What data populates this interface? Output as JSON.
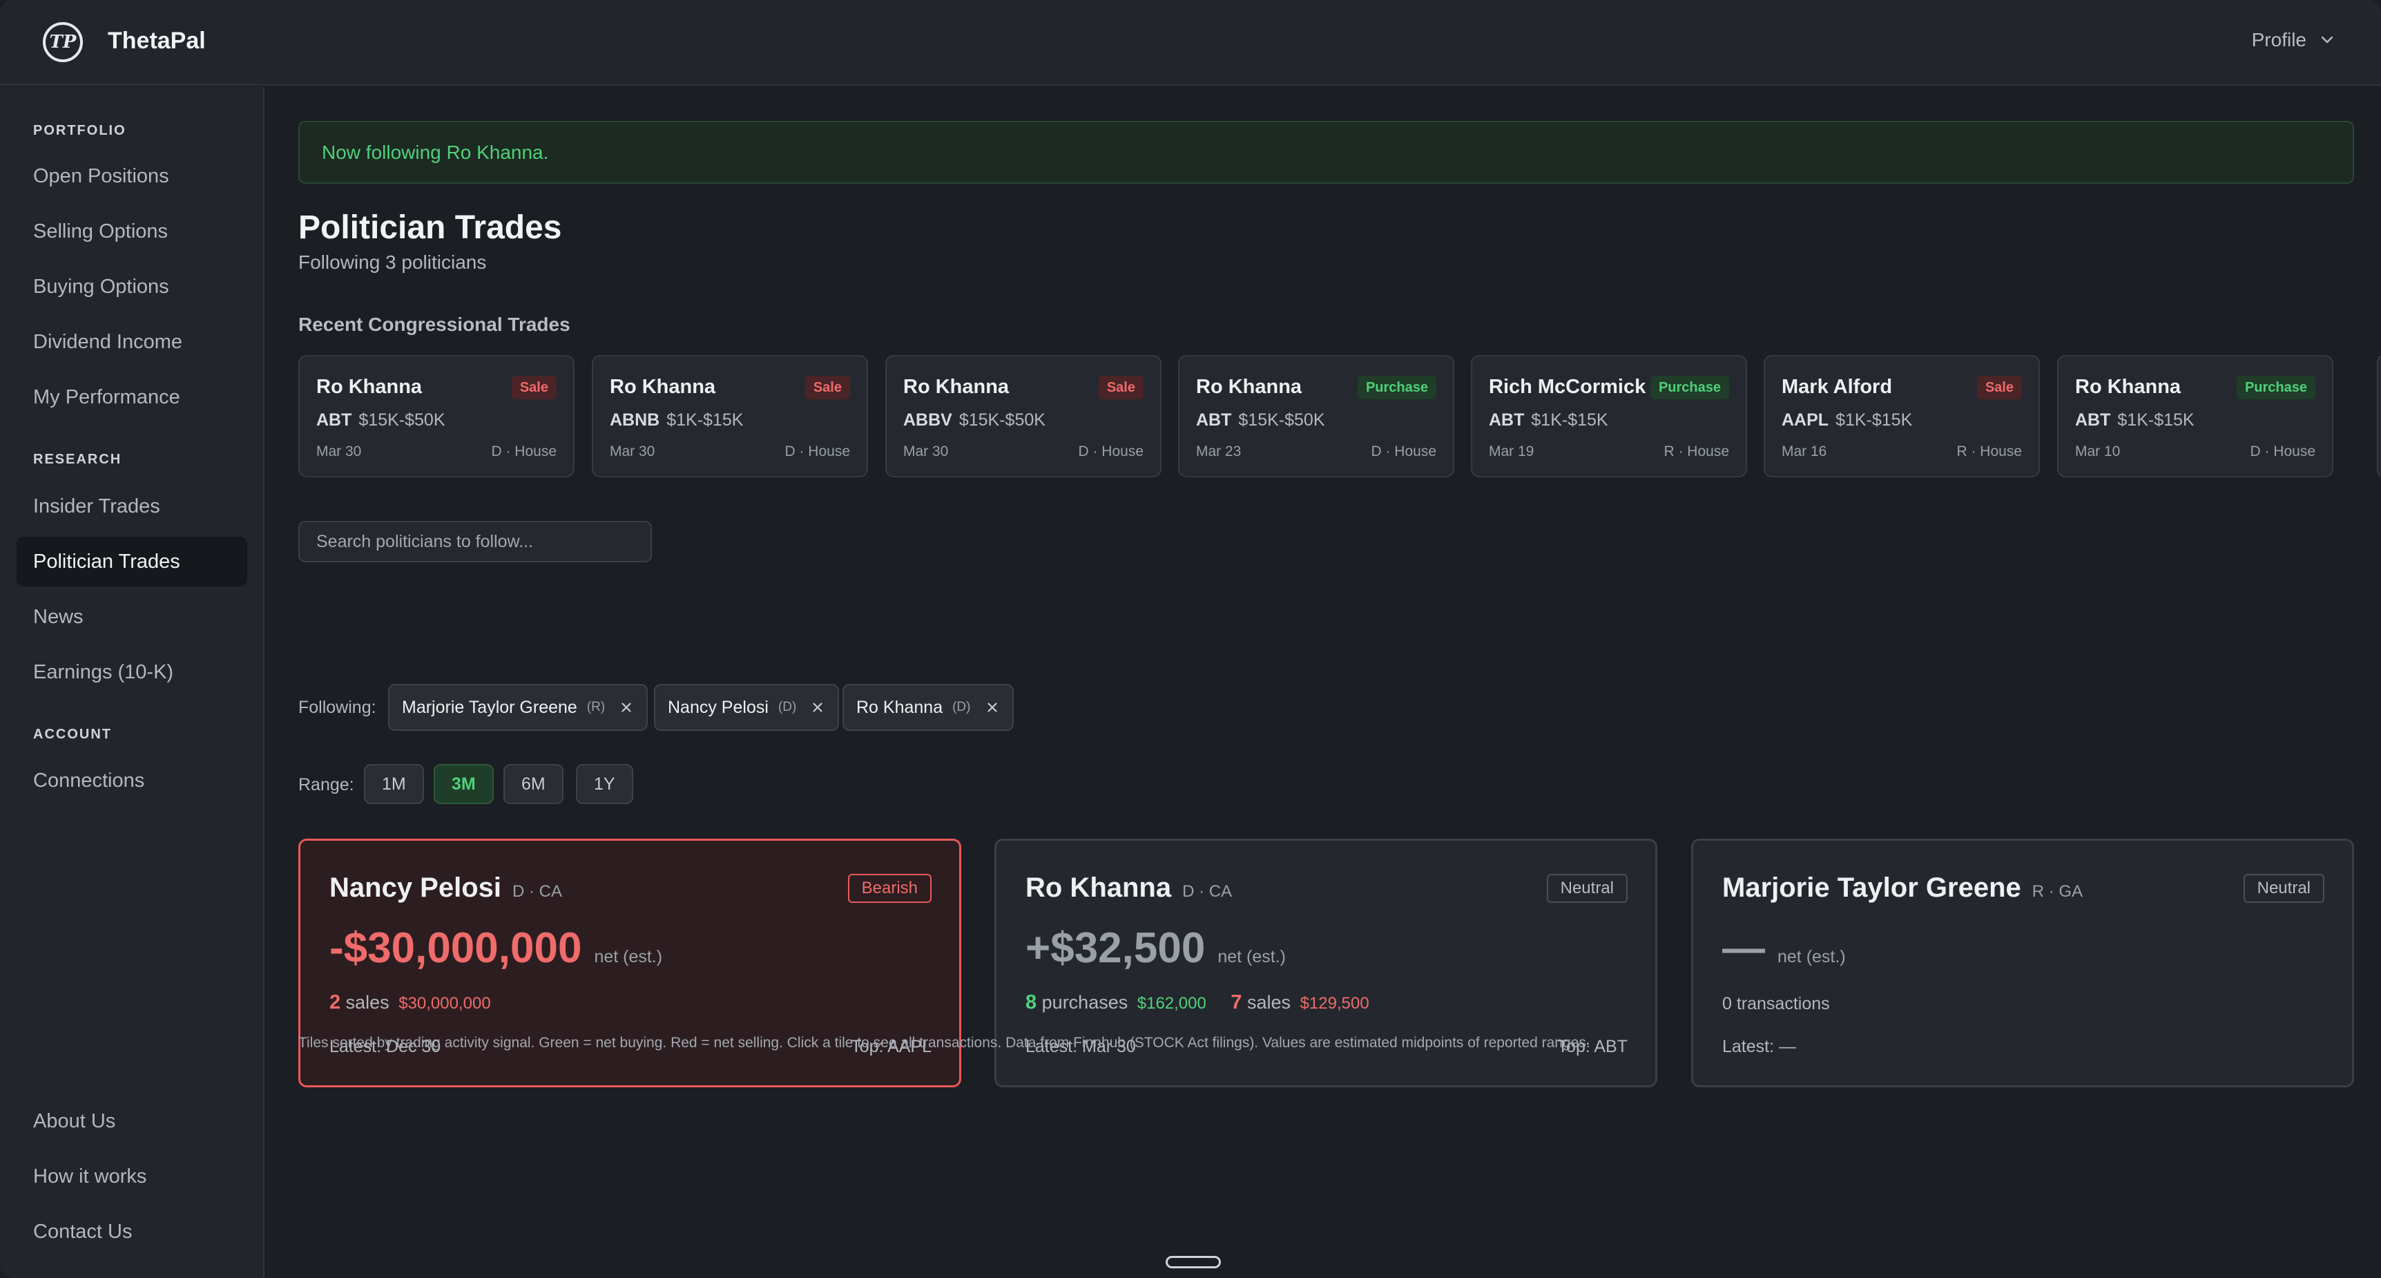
{
  "app": {
    "brand": "ThetaPal",
    "logo_text": "TP",
    "profile_label": "Profile"
  },
  "sidebar": {
    "sections": [
      {
        "title": "PORTFOLIO",
        "items": [
          "Open Positions",
          "Selling Options",
          "Buying Options",
          "Dividend Income",
          "My Performance"
        ]
      },
      {
        "title": "RESEARCH",
        "items": [
          "Insider Trades",
          "Politician Trades",
          "News",
          "Earnings (10-K)"
        ]
      },
      {
        "title": "ACCOUNT",
        "items": [
          "Connections"
        ]
      }
    ],
    "active_item": "Politician Trades",
    "footer_items": [
      "About Us",
      "How it works",
      "Contact Us"
    ]
  },
  "main": {
    "alert": "Now following Ro Khanna.",
    "title": "Politician Trades",
    "subtitle": "Following 3 politicians",
    "recent_label": "Recent Congressional Trades",
    "recent_trades": [
      {
        "name": "Ro Khanna",
        "type": "Sale",
        "ticker": "ABT",
        "range": "$15K-$50K",
        "date": "Mar 30",
        "party": "D · House"
      },
      {
        "name": "Ro Khanna",
        "type": "Sale",
        "ticker": "ABNB",
        "range": "$1K-$15K",
        "date": "Mar 30",
        "party": "D · House"
      },
      {
        "name": "Ro Khanna",
        "type": "Sale",
        "ticker": "ABBV",
        "range": "$15K-$50K",
        "date": "Mar 30",
        "party": "D · House"
      },
      {
        "name": "Ro Khanna",
        "type": "Purchase",
        "ticker": "ABT",
        "range": "$15K-$50K",
        "date": "Mar 23",
        "party": "D · House"
      },
      {
        "name": "Rich McCormick",
        "type": "Purchase",
        "ticker": "ABT",
        "range": "$1K-$15K",
        "date": "Mar 19",
        "party": "R · House"
      },
      {
        "name": "Mark Alford",
        "type": "Sale",
        "ticker": "AAPL",
        "range": "$1K-$15K",
        "date": "Mar 16",
        "party": "R · House"
      },
      {
        "name": "Ro Khanna",
        "type": "Purchase",
        "ticker": "ABT",
        "range": "$1K-$15K",
        "date": "Mar 10",
        "party": "D · House"
      }
    ],
    "search_placeholder": "Search politicians to follow...",
    "following_label": "Following:",
    "following": [
      {
        "name": "Marjorie Taylor Greene",
        "party": "(R)"
      },
      {
        "name": "Nancy Pelosi",
        "party": "(D)"
      },
      {
        "name": "Ro Khanna",
        "party": "(D)"
      }
    ],
    "range_label": "Range:",
    "ranges": [
      "1M",
      "3M",
      "6M",
      "1Y"
    ],
    "active_range": "3M",
    "politicians": [
      {
        "name": "Nancy Pelosi",
        "meta": "D · CA",
        "signal": "Bearish",
        "net": "-$30,000,000",
        "net_label": "net (est.)",
        "purchases_count": "",
        "purchases_label": "",
        "purchases_amount": "",
        "sales_count": "2",
        "sales_label": "sales",
        "sales_amount": "$30,000,000",
        "transactions": "",
        "latest": "Latest: Dec 30",
        "top": "Top: AAPL"
      },
      {
        "name": "Ro Khanna",
        "meta": "D · CA",
        "signal": "Neutral",
        "net": "+$32,500",
        "net_label": "net (est.)",
        "purchases_count": "8",
        "purchases_label": "purchases",
        "purchases_amount": "$162,000",
        "sales_count": "7",
        "sales_label": "sales",
        "sales_amount": "$129,500",
        "transactions": "",
        "latest": "Latest: Mar 30",
        "top": "Top: ABT"
      },
      {
        "name": "Marjorie Taylor Greene",
        "meta": "R · GA",
        "signal": "Neutral",
        "net": "—",
        "net_label": "net (est.)",
        "purchases_count": "",
        "purchases_label": "",
        "purchases_amount": "",
        "sales_count": "",
        "sales_label": "",
        "sales_amount": "",
        "transactions": "0 transactions",
        "latest": "Latest: —",
        "top": ""
      }
    ],
    "footnote": "Tiles sorted by trading activity signal. Green = net buying. Red = net selling. Click a tile to see all transactions. Data from Finnhub (STOCK Act filings). Values are estimated midpoints of reported ranges."
  },
  "colors": {
    "accent_green": "#4fd17a",
    "accent_red": "#f06b6b",
    "background": "#1b1e23",
    "panel": "#22262c"
  }
}
